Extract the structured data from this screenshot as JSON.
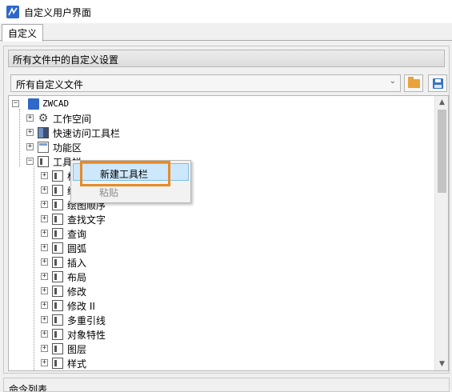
{
  "window": {
    "title": "自定义用户界面",
    "app_icon": "zwcad-logo-icon"
  },
  "tabs": [
    {
      "label": "自定义",
      "selected": true
    }
  ],
  "customize_panel": {
    "header": "所有文件中的自定义设置",
    "file_select": {
      "value": "所有自定义文件"
    },
    "buttons": {
      "open": "folder-icon",
      "save": "save-icon"
    }
  },
  "tree": {
    "root": {
      "label": "ZWCAD",
      "expanded": true
    },
    "top_nodes": [
      {
        "label": "工作空间",
        "icon": "gear-icon",
        "expanded": false
      },
      {
        "label": "快速访问工具栏",
        "icon": "quick-access-icon",
        "expanded": false
      },
      {
        "label": "功能区",
        "icon": "ribbon-icon",
        "expanded": false
      },
      {
        "label": "工具栏",
        "icon": "toolbar-icon",
        "expanded": true
      }
    ],
    "toolbar_children": [
      {
        "label": "标"
      },
      {
        "label": "绘"
      },
      {
        "label": "绘图顺序"
      },
      {
        "label": "查找文字"
      },
      {
        "label": "查询"
      },
      {
        "label": "圆弧"
      },
      {
        "label": "插入"
      },
      {
        "label": "布局"
      },
      {
        "label": "修改"
      },
      {
        "label": "修改 II"
      },
      {
        "label": "多重引线"
      },
      {
        "label": "对象特性"
      },
      {
        "label": "图层"
      },
      {
        "label": "样式"
      }
    ]
  },
  "context_menu": {
    "items": [
      {
        "label": "新建工具栏",
        "highlighted": true,
        "enabled": true
      },
      {
        "label": "粘贴",
        "highlighted": false,
        "enabled": false
      }
    ],
    "highlight_color": "#e88a26"
  },
  "bottom_panel": {
    "header": "命令列表"
  }
}
